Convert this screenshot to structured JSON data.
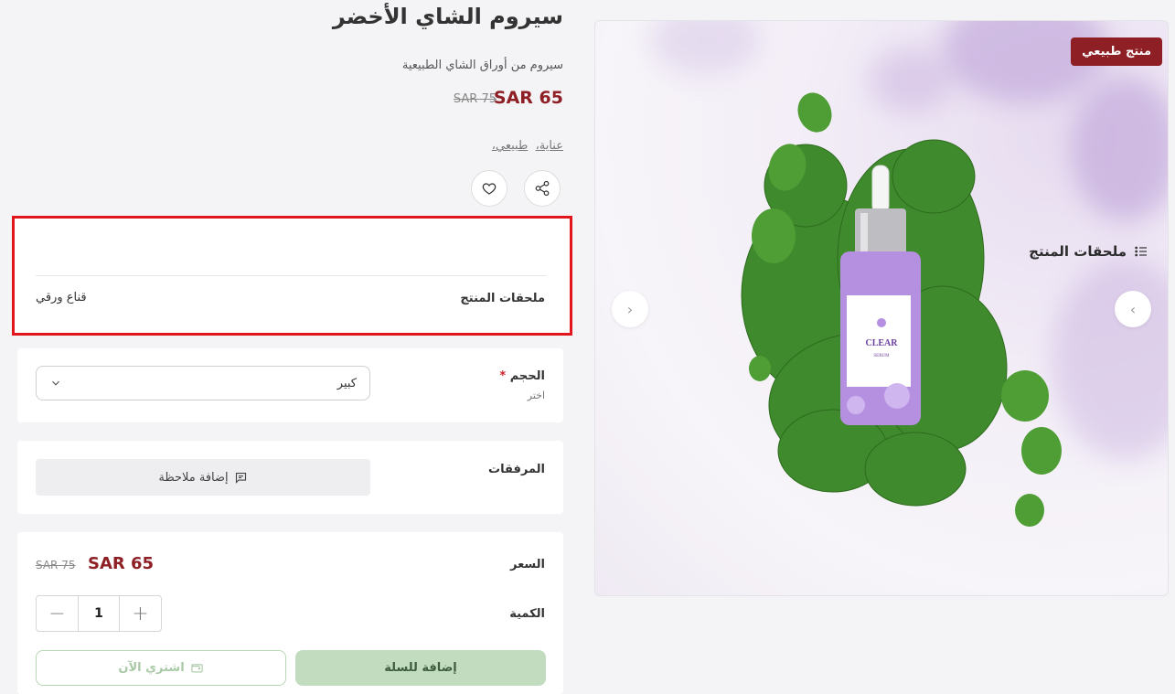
{
  "product": {
    "title": "سيروم الشاي الأخضر",
    "subtitle": "سيروم من أوراق الشاي الطبيعية",
    "price": "SAR 65",
    "old_price": "SAR 75",
    "tags": [
      "عناية،",
      "طبيعي،"
    ],
    "badge": "منتج طبيعي",
    "label_brand": "CLEAR",
    "label_sub": "SERUM"
  },
  "actions": {
    "share_icon": "share-icon",
    "wishlist_icon": "heart-icon"
  },
  "addons": {
    "heading": "ملحقات المنتج",
    "row_label": "ملحقات المنتج",
    "row_value": "قناع ورقي"
  },
  "size_option": {
    "label": "الحجم",
    "required_mark": "*",
    "hint": "اختر",
    "selected": "كبير"
  },
  "attachments": {
    "label": "المرفقات",
    "add_note": "إضافة ملاحظة"
  },
  "summary": {
    "price_label": "السعر",
    "price": "SAR 65",
    "old_price": "SAR 75",
    "quantity_label": "الكمية",
    "quantity": "1"
  },
  "buttons": {
    "add_to_cart": "إضافة للسلة",
    "buy_now": "اشتري الآن"
  },
  "colors": {
    "accent": "#8e1f24",
    "highlight_border": "#e2141c",
    "cart_button": "#c2dcc0"
  }
}
